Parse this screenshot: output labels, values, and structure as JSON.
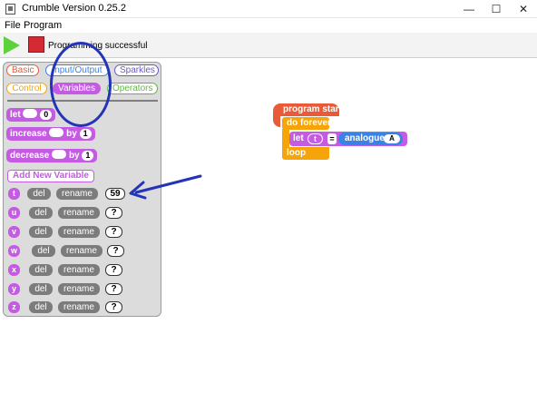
{
  "window": {
    "title": "Crumble Version 0.25.2",
    "min_glyph": "—",
    "max_glyph": "☐",
    "close_glyph": "✕"
  },
  "menu": {
    "file": "File",
    "program": "Program"
  },
  "toolbar": {
    "run_icon": "play-icon",
    "stop_icon": "stop-icon",
    "status": "Programming successful"
  },
  "palette": {
    "categories": [
      {
        "label": "Basic",
        "color": "#e95a38"
      },
      {
        "label": "Input/Output",
        "color": "#3a83e6"
      },
      {
        "label": "Sparkles",
        "color": "#6a5ac8"
      },
      {
        "label": "Control",
        "color": "#f5a40a"
      },
      {
        "label": "Variables",
        "color": "#c55be3",
        "selected": true
      },
      {
        "label": "Operators",
        "color": "#5dbb3c"
      }
    ],
    "blocks": {
      "let_label": "let",
      "let_value": "0",
      "increase_label": "increase",
      "increase_by": "by",
      "increase_value": "1",
      "decrease_label": "decrease",
      "decrease_by": "by",
      "decrease_value": "1"
    },
    "add_variable": "Add New Variable",
    "del_label": "del",
    "rename_label": "rename",
    "variables": [
      {
        "name": "t",
        "value": "59"
      },
      {
        "name": "u",
        "value": "?"
      },
      {
        "name": "v",
        "value": "?"
      },
      {
        "name": "w",
        "value": "?"
      },
      {
        "name": "x",
        "value": "?"
      },
      {
        "name": "y",
        "value": "?"
      },
      {
        "name": "z",
        "value": "?"
      }
    ]
  },
  "program": {
    "start": "program start",
    "do_forever": "do forever",
    "let": "let",
    "var": "t",
    "equals": "=",
    "analogue": "analogue",
    "pin": "A",
    "loop": "loop"
  },
  "annotations": {
    "circle_color": "#2434b8",
    "arrow_color": "#2434b8"
  }
}
